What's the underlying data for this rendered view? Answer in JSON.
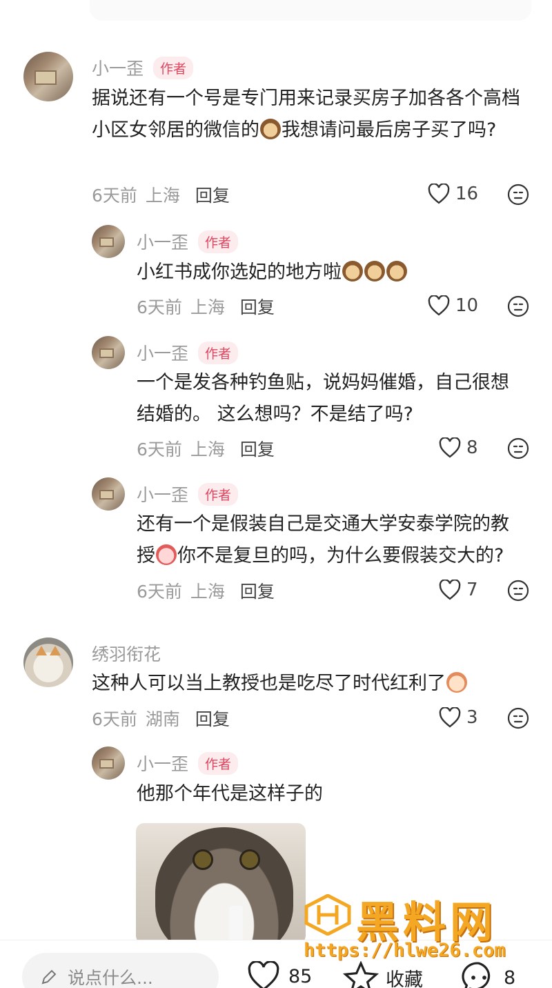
{
  "comments": [
    {
      "author": "小一歪",
      "tag": "作者",
      "text_before": "据说还有一个号是专门用来记录买房子加各各个高档小区女邻居的微信的",
      "text_after": "我想请问最后房子买了吗?",
      "emoji": "dog-emoji",
      "time": "6天前",
      "location": "上海",
      "reply": "回复",
      "likes": "16",
      "replies": [
        {
          "author": "小一歪",
          "tag": "作者",
          "text": "小红书成你选妃的地方啦",
          "emojis": [
            "dog-emoji",
            "dog-emoji",
            "dog-emoji"
          ],
          "time": "6天前",
          "location": "上海",
          "reply": "回复",
          "likes": "10"
        },
        {
          "author": "小一歪",
          "tag": "作者",
          "text_line1": "一个是发各种钓鱼贴，说妈妈催婚，自己很想",
          "text_line2": "结婚的。 这么想吗？不是结了吗?",
          "time": "6天前",
          "location": "上海",
          "reply": "回复",
          "likes": "8"
        },
        {
          "author": "小一歪",
          "tag": "作者",
          "text_line1": "还有一个是假装自己是交通大学安泰学院的教",
          "text_before": "授",
          "text_after": "你不是复旦的吗，为什么要假装交大的?",
          "emoji": "crying-emoji",
          "time": "6天前",
          "location": "上海",
          "reply": "回复",
          "likes": "7"
        }
      ]
    },
    {
      "author": "绣羽衔花",
      "text": "这种人可以当上教授也是吃尽了时代红利了",
      "emoji": "rich-emoji",
      "time": "6天前",
      "location": "湖南",
      "reply": "回复",
      "likes": "3",
      "replies": [
        {
          "author": "小一歪",
          "tag": "作者",
          "text": "他那个年代是这样子的",
          "image": "cat-drinking-milk-photo"
        }
      ]
    }
  ],
  "bottom_bar": {
    "input_placeholder": "说点什么...",
    "likes": "85",
    "favorite_label": "收藏",
    "comments": "8"
  },
  "watermark": {
    "title": "黑料网",
    "url": "https://hlwe26.com"
  },
  "colors": {
    "author_tag_bg": "#fdecee",
    "author_tag_text": "#e0455f",
    "meta_gray": "#9a9a9a",
    "watermark_orange": "#f4a722"
  }
}
